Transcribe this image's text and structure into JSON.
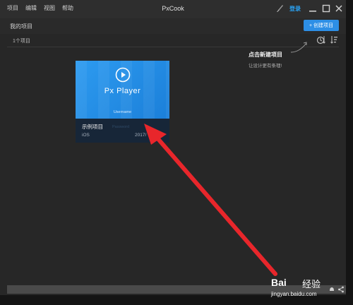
{
  "menu": [
    "项目",
    "编辑",
    "视图",
    "帮助"
  ],
  "app_title": "PxCook",
  "login_label": "登录",
  "toolbar": {
    "my_projects": "我的项目",
    "new_project": "+ 创建项目"
  },
  "project_count": "1个项目",
  "hint": {
    "title": "点击新建项目",
    "subtitle": "让设计更有条理!"
  },
  "card": {
    "brand": "Px Player",
    "username": "Username",
    "name": "示例项目",
    "platform": "iOS",
    "date": "2017/",
    "ghost": "Password"
  },
  "watermark": {
    "logo": "Bai",
    "text": "经验",
    "url": "jingyan.baidu.com"
  },
  "colors": {
    "accent": "#2aa3f4",
    "button": "#2d8fe6",
    "arrow": "#e8262b"
  }
}
